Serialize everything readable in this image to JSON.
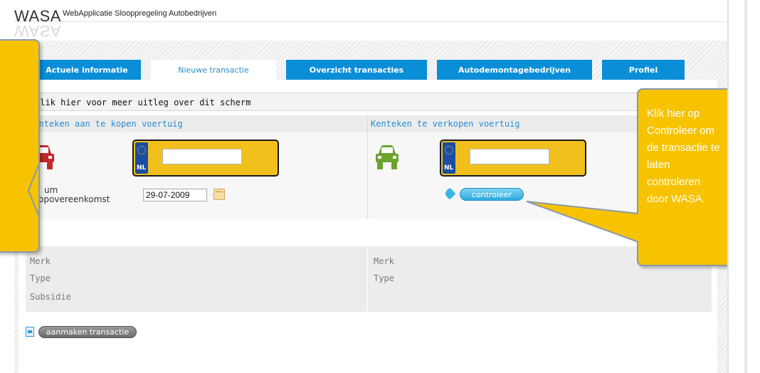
{
  "header": {
    "logo": "WASA",
    "app_title": "WebApplicatie Slooppregeling Autobedrijven"
  },
  "tabs": [
    {
      "label": "Actuele informatie"
    },
    {
      "label": "Nieuwe transactie"
    },
    {
      "label": "Overzicht transacties"
    },
    {
      "label": "Autodemontagebedrijven"
    },
    {
      "label": "Profiel"
    }
  ],
  "help_bar": "Klik hier voor meer uitleg over dit scherm",
  "left": {
    "section_title": "Kenteken aan te kopen voertuig",
    "plate_country": "NL",
    "plate_value": "",
    "date_label_line1": "um",
    "date_label_line2": "opovereenkomst",
    "date_value": "29-07-2009",
    "info": [
      "Merk",
      "Type",
      "Subsidie"
    ]
  },
  "right": {
    "section_title": "Kenteken te verkopen voertuig",
    "plate_country": "NL",
    "plate_value": "",
    "controleer_label": "controleer",
    "info": [
      "Merk",
      "Type"
    ]
  },
  "aanmaken_label": "aanmaken transactie",
  "callout": {
    "text": "Klik hier op\nControleer om\nde transactie te\nlaten\ncontroleren\ndoor WASA."
  },
  "colors": {
    "tab_blue": "#0b8ed8",
    "callout_yellow": "#f7c300",
    "plate_yellow": "#f2c01c",
    "car_left": "#c1272d",
    "car_right": "#6ba32e",
    "link_blue": "#2b8ed0"
  }
}
